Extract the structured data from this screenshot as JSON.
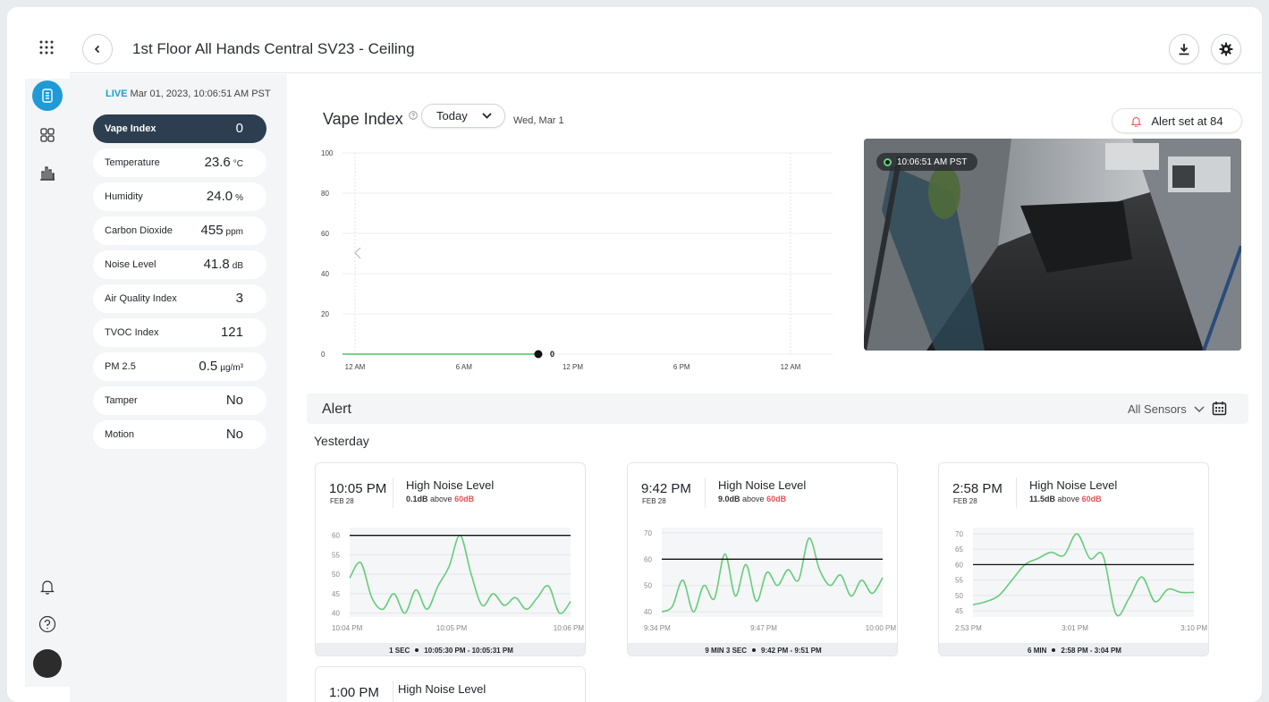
{
  "header": {
    "title": "1st Floor All Hands Central SV23 - Ceiling"
  },
  "colors": {
    "accent": "#1e9bd7",
    "selected": "#2c3e50",
    "series": "#66cc7a",
    "alert": "#e55353"
  },
  "sensors": {
    "live_tag": "LIVE",
    "live_time": "Mar 01, 2023, 10:06:51 AM PST",
    "items": [
      {
        "label": "Vape Index",
        "value": "0",
        "unit": ""
      },
      {
        "label": "Temperature",
        "value": "23.6",
        "unit": "°C"
      },
      {
        "label": "Humidity",
        "value": "24.0",
        "unit": "%"
      },
      {
        "label": "Carbon Dioxide",
        "value": "455",
        "unit": "ppm"
      },
      {
        "label": "Noise Level",
        "value": "41.8",
        "unit": "dB"
      },
      {
        "label": "Air Quality Index",
        "value": "3",
        "unit": ""
      },
      {
        "label": "TVOC Index",
        "value": "121",
        "unit": ""
      },
      {
        "label": "PM 2.5",
        "value": "0.5",
        "unit": "µg/m³"
      },
      {
        "label": "Tamper",
        "value": "No",
        "unit": ""
      },
      {
        "label": "Motion",
        "value": "No",
        "unit": ""
      }
    ]
  },
  "vape": {
    "title": "Vape Index",
    "range_label": "Today",
    "date_label": "Wed, Mar 1",
    "alert_label": "Alert set at 84",
    "camera_time": "10:06:51 AM PST"
  },
  "alerts": {
    "title": "Alert",
    "filter_label": "All Sensors",
    "group_label": "Yesterday",
    "cards": [
      {
        "time": "10:05 PM",
        "date": "FEB 28",
        "title": "High Noise Level",
        "delta": "0.1dB",
        "above": "above",
        "threshold": "60dB",
        "duration": "1 SEC",
        "range": "10:05:30 PM - 10:05:31 PM"
      },
      {
        "time": "9:42 PM",
        "date": "FEB 28",
        "title": "High Noise Level",
        "delta": "9.0dB",
        "above": "above",
        "threshold": "60dB",
        "duration": "9 MIN 3 SEC",
        "range": "9:42 PM - 9:51 PM"
      },
      {
        "time": "2:58 PM",
        "date": "FEB 28",
        "title": "High Noise Level",
        "delta": "11.5dB",
        "above": "above",
        "threshold": "60dB",
        "duration": "6 MIN",
        "range": "2:58 PM - 3:04 PM"
      },
      {
        "time": "1:00 PM",
        "title": "High Noise Level"
      }
    ]
  },
  "chart_data": [
    {
      "type": "line",
      "x_ticks": [
        "12 AM",
        "6 AM",
        "12 PM",
        "6 PM",
        "12 AM"
      ],
      "y_ticks": [
        0,
        20,
        40,
        60,
        80,
        100
      ],
      "ylim": [
        0,
        100
      ],
      "series": [
        {
          "x_hours": [
            0,
            2,
            4,
            6,
            8,
            10.1
          ],
          "values": [
            0,
            0,
            0,
            0,
            0,
            0
          ]
        }
      ],
      "last_value_label": "0"
    },
    {
      "type": "line",
      "x_ticks": [
        "10:04 PM",
        "10:05 PM",
        "10:06 PM"
      ],
      "y_ticks": [
        40,
        45,
        50,
        55,
        60
      ],
      "ylim": [
        39,
        62
      ],
      "threshold": 60,
      "series": [
        {
          "values": [
            49,
            53,
            44,
            41,
            45,
            40,
            46,
            41,
            47,
            52,
            60,
            50,
            42,
            45,
            42,
            44,
            41,
            44,
            47,
            40,
            43
          ]
        }
      ]
    },
    {
      "type": "line",
      "x_ticks": [
        "9:34 PM",
        "9:47 PM",
        "10:00 PM"
      ],
      "y_ticks": [
        40,
        50,
        60,
        70
      ],
      "ylim": [
        38,
        72
      ],
      "threshold": 60,
      "series": [
        {
          "values": [
            40,
            42,
            52,
            40,
            50,
            45,
            62,
            46,
            58,
            44,
            55,
            50,
            56,
            52,
            68,
            56,
            50,
            54,
            46,
            52,
            47,
            53
          ]
        }
      ]
    },
    {
      "type": "line",
      "x_ticks": [
        "2:53 PM",
        "3:01 PM",
        "3:10 PM"
      ],
      "y_ticks": [
        45,
        50,
        55,
        60,
        65,
        70
      ],
      "ylim": [
        43,
        72
      ],
      "threshold": 60,
      "series": [
        {
          "values": [
            47,
            48,
            50,
            55,
            60,
            62,
            64,
            63,
            70,
            62,
            63,
            44,
            49,
            56,
            48,
            52,
            51,
            51
          ]
        }
      ]
    }
  ]
}
